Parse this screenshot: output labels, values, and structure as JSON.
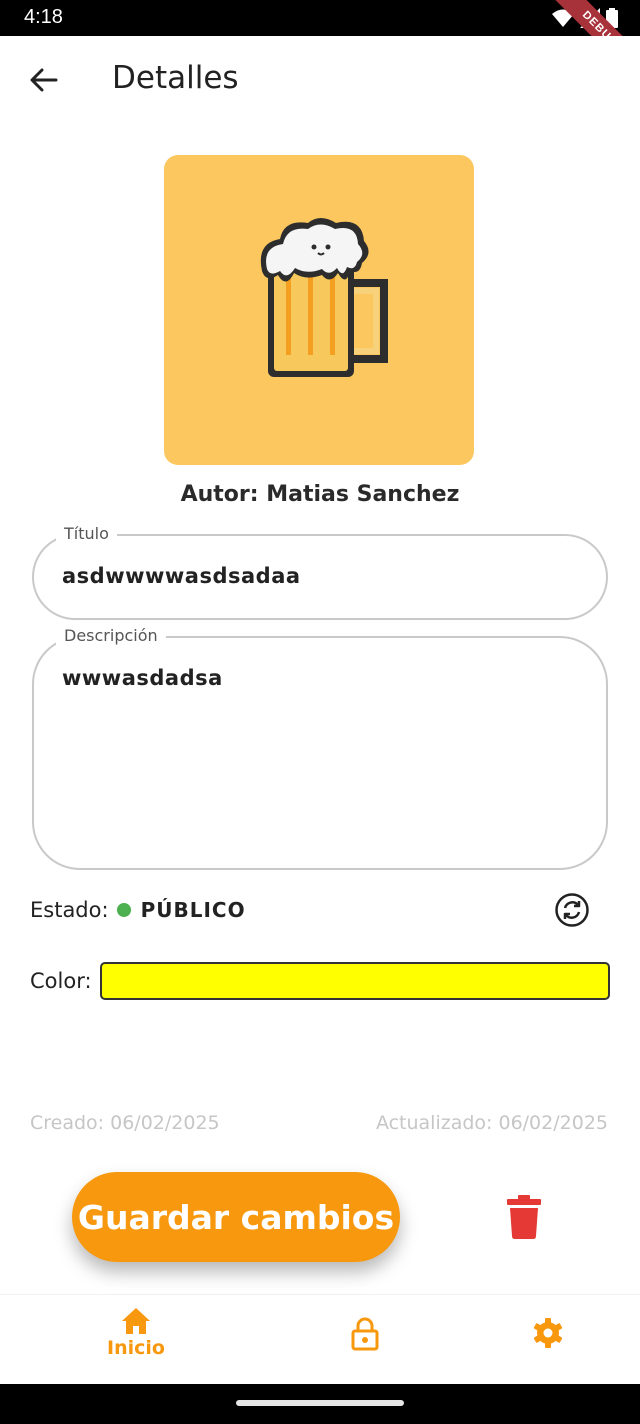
{
  "status_bar": {
    "time": "4:18",
    "icons": [
      "wifi-icon",
      "signal-icon",
      "battery-icon"
    ],
    "debug_banner": "DEBUG"
  },
  "app_bar": {
    "back_icon": "arrow-left-icon",
    "title": "Detalles"
  },
  "cover": {
    "background": "#fbc75e",
    "icon": "beer-mug-icon"
  },
  "author": "Autor: Matias Sanchez",
  "form": {
    "title_label": "Título",
    "title_value": "asdwwwwasdsadaa",
    "description_label": "Descripción",
    "description_value": "wwwasdadsa"
  },
  "estado": {
    "label": "Estado:",
    "value": "PÚBLICO",
    "dot_color": "#4caf50",
    "toggle_icon": "sync-icon"
  },
  "color": {
    "label": "Color:",
    "value": "#ffff00"
  },
  "dates": {
    "created": "Creado: 06/02/2025",
    "updated": "Actualizado: 06/02/2025"
  },
  "actions": {
    "save_label": "Guardar cambios",
    "delete_icon": "trash-icon",
    "accent": "#f7980e",
    "danger": "#e53935"
  },
  "bottom_nav": {
    "items": [
      {
        "label": "Inicio",
        "icon": "home-icon",
        "active": true
      },
      {
        "label": "",
        "icon": "lock-icon",
        "active": false
      },
      {
        "label": "",
        "icon": "gear-icon",
        "active": false
      }
    ]
  }
}
